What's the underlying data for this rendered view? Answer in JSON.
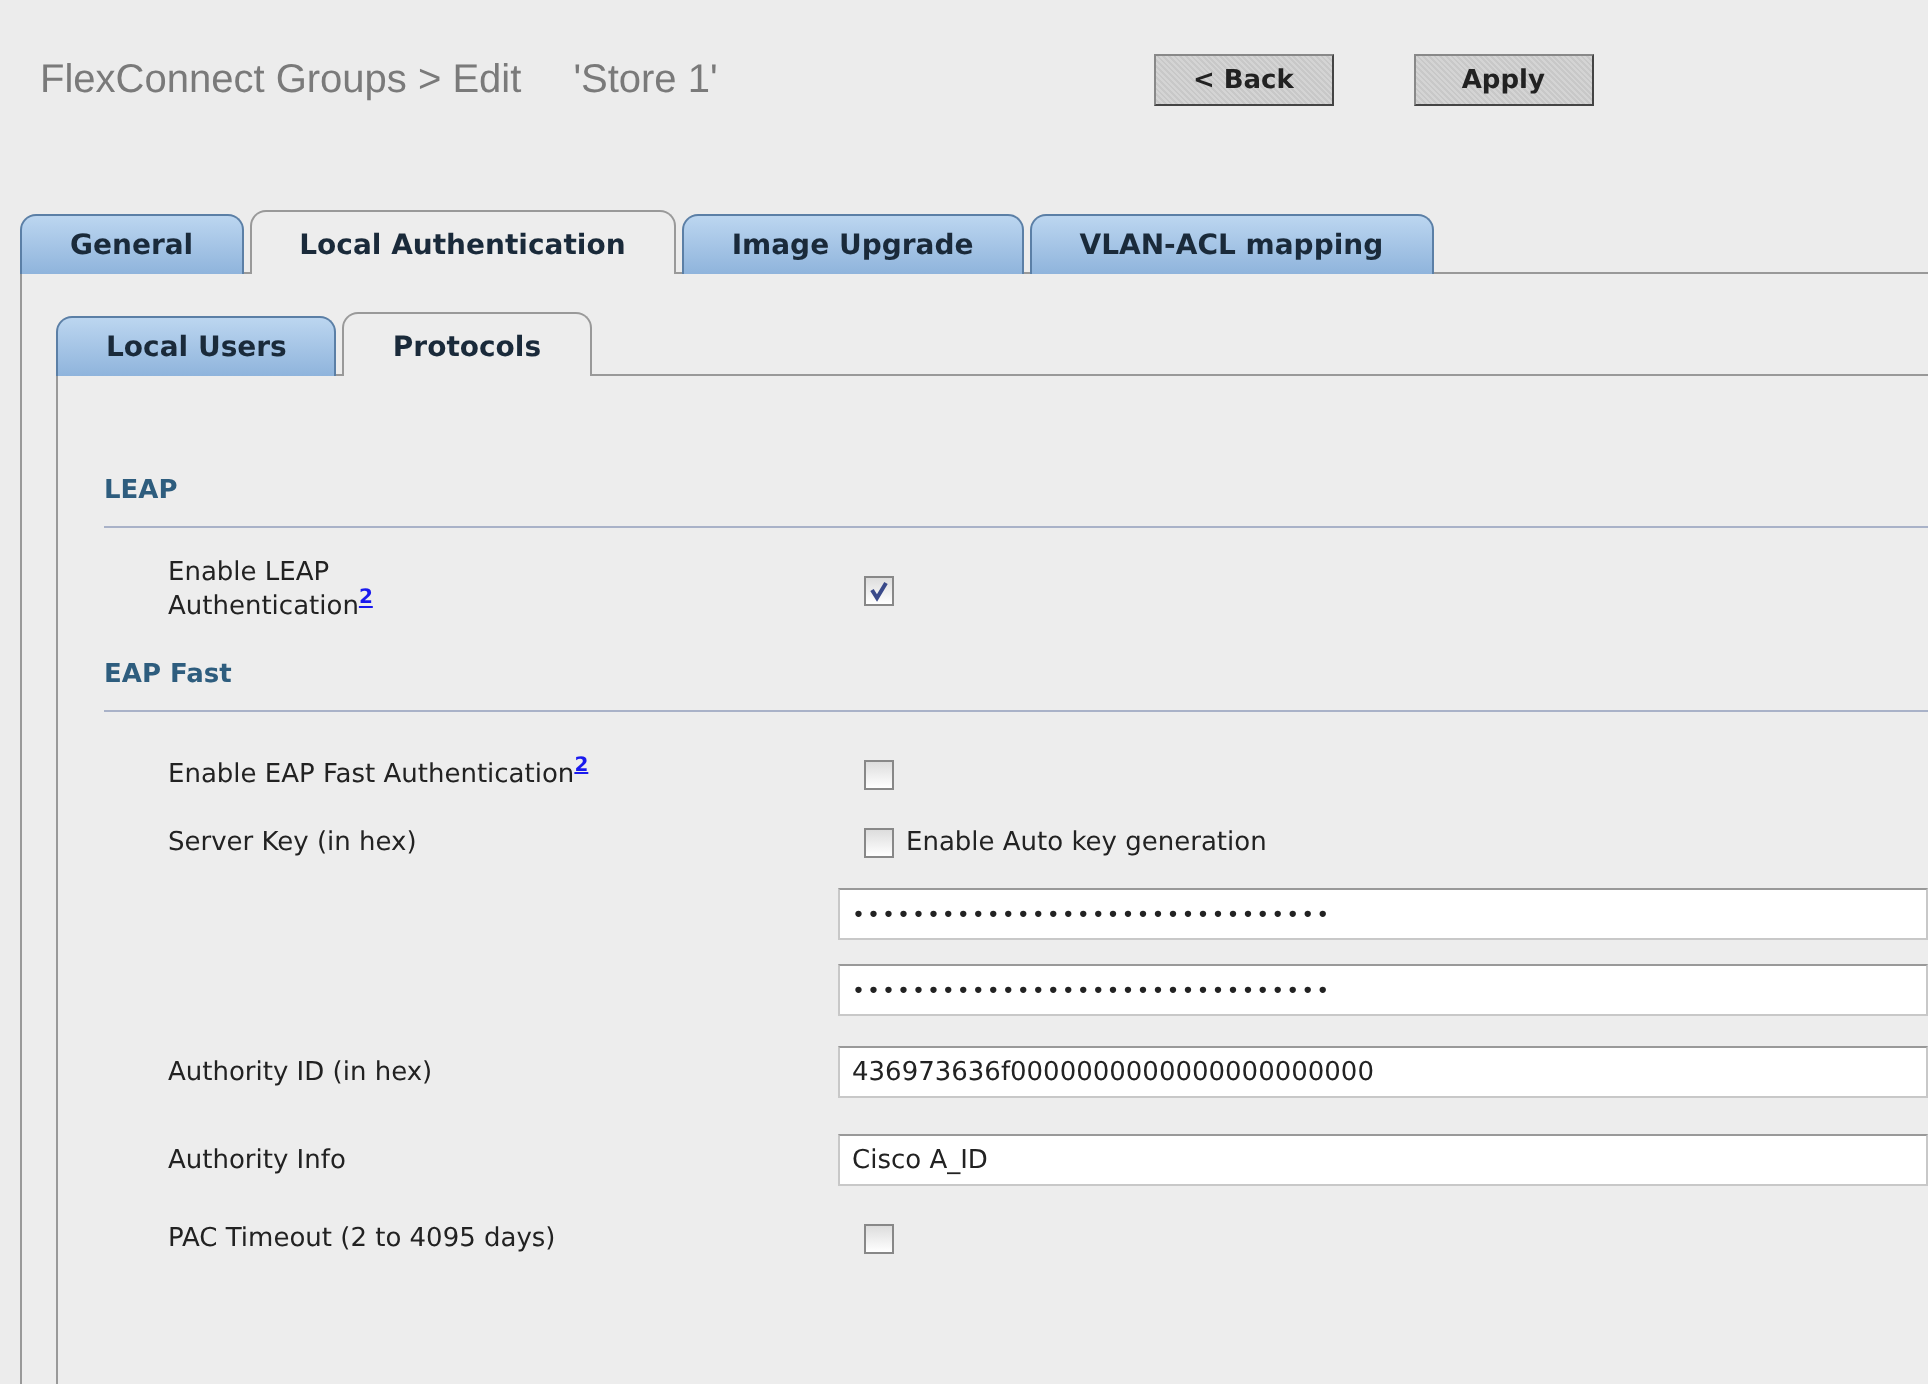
{
  "header": {
    "title": "FlexConnect Groups > Edit",
    "group_name": "'Store 1'"
  },
  "buttons": [
    {
      "label": "< Back"
    },
    {
      "label": "Apply"
    }
  ],
  "tabs": [
    {
      "label": "General",
      "selected": false
    },
    {
      "label": "Local Authentication",
      "selected": true
    },
    {
      "label": "Image Upgrade",
      "selected": false
    },
    {
      "label": "VLAN-ACL mapping",
      "selected": false
    }
  ],
  "subtabs": [
    {
      "label": "Local Users",
      "selected": false
    },
    {
      "label": "Protocols",
      "selected": true
    }
  ],
  "sections": [
    {
      "heading": "LEAP",
      "rows": [
        {
          "kind": "checkbox",
          "label": "Enable LEAP Authentication",
          "footnote": "2",
          "checked": true
        }
      ]
    },
    {
      "heading": "EAP Fast",
      "rows": [
        {
          "kind": "checkbox",
          "label": "Enable EAP Fast Authentication",
          "footnote": "2",
          "checked": false
        },
        {
          "kind": "checkbox_option",
          "label": "Server Key (in hex)",
          "option": "Enable Auto key generation",
          "checked": false
        },
        {
          "kind": "field",
          "value": "••••••••••••••••••••••••••••••••"
        },
        {
          "kind": "field",
          "value": "••••••••••••••••••••••••••••••••"
        },
        {
          "kind": "field",
          "label": "Authority ID (in hex)",
          "value": "436973636f0000000000000000000000"
        },
        {
          "kind": "field",
          "label": "Authority Info",
          "value": "Cisco A_ID"
        },
        {
          "kind": "checkbox",
          "label": "PAC Timeout (2 to 4095 days)",
          "checked": false
        }
      ]
    }
  ]
}
